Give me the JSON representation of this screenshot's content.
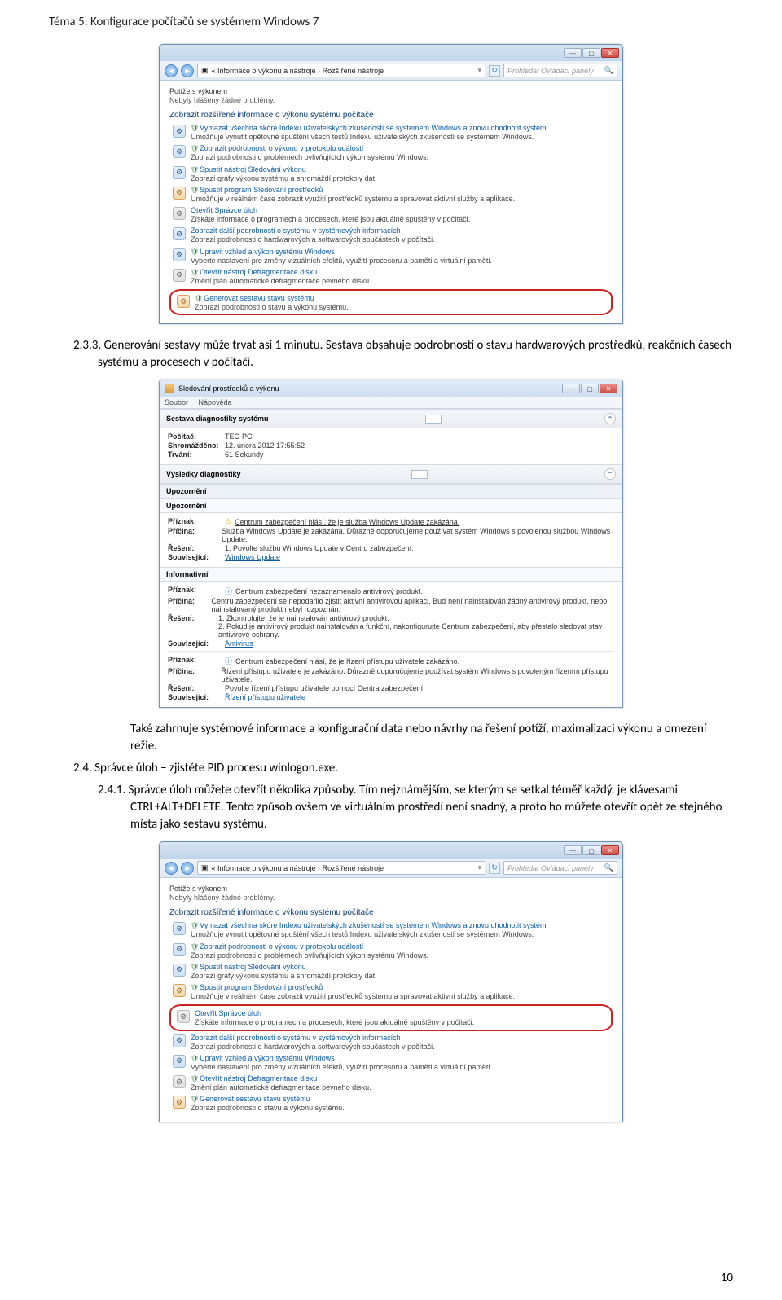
{
  "doc": {
    "header": "Téma 5: Konfigurace počítačů se systémem Windows 7",
    "page_number": "10",
    "p233": "2.3.3.  Generování sestavy může trvat asi 1 minutu. Sestava obsahuje podrobnosti o stavu hardwarových prostředků, reakčních časech systému a procesech v počítači.",
    "p_after_report": "Také zahrnuje systémové informace a konfigurační data nebo návrhy na řešení potíží, maximalizaci výkonu a omezení režie.",
    "p24": "2.4.  Správce úloh – zjistěte PID procesu winlogon.exe.",
    "p241": "2.4.1.  Správce úloh můžete otevřít několika způsoby. Tím nejznámějším, se kterým se setkal téměř každý, je klávesami CTRL+ALT+DELETE. Tento způsob ovšem ve virtuálním prostředí není snadný, a proto ho můžete otevřít opět ze stejného místa jako sestavu systému."
  },
  "cp": {
    "breadcrumb_a": "Informace o výkonu a nástroje",
    "breadcrumb_b": "Rozšířené nástroje",
    "search_placeholder": "Prohledat Ovládací panely",
    "issues_head": "Potíže s výkonem",
    "issues_none": "Nebyly hlášeny žádné problémy.",
    "section": "Zobrazit rozšířené informace o výkonu systému počítače",
    "tools": [
      {
        "title": "Vymazat všechna skóre Indexu uživatelských zkušeností se systémem Windows a znovu ohodnotit systém",
        "desc": "Umožňuje vynutit opětovné spuštění všech testů Indexu uživatelských zkušeností se systémem Windows.",
        "shield": true,
        "icon": "blue"
      },
      {
        "title": "Zobrazit podrobnosti o výkonu v protokolu událostí",
        "desc": "Zobrazí podrobnosti o problémech ovlivňujících výkon systému Windows.",
        "shield": true,
        "icon": "blue"
      },
      {
        "title": "Spustit nástroj Sledování výkonu",
        "desc": "Zobrazí grafy výkonu systému a shromáždí protokoly dat.",
        "shield": true,
        "icon": "blue"
      },
      {
        "title": "Spustit program Sledování prostředků",
        "desc": "Umožňuje v reálném čase zobrazit využití prostředků systému a spravovat aktivní služby a aplikace.",
        "shield": true,
        "icon": "orange"
      },
      {
        "title": "Otevřít Správce úloh",
        "desc": "Získáte informace o programech a procesech, které jsou aktuálně spuštěny v počítači.",
        "shield": false,
        "icon": "grey"
      },
      {
        "title": "Zobrazit další podrobnosti o systému v systémových informacích",
        "desc": "Zobrazí podrobnosti o hardwarových a softwarových součástech v počítači.",
        "shield": false,
        "icon": "blue"
      },
      {
        "title": "Upravit vzhled a výkon systému Windows",
        "desc": "Vyberte nastavení pro změny vizuálních efektů, využití procesoru a paměti a virtuální paměti.",
        "shield": true,
        "icon": "blue"
      },
      {
        "title": "Otevřít nástroj Defragmentace disku",
        "desc": "Změní plán automatické defragmentace pevného disku.",
        "shield": true,
        "icon": "grey"
      },
      {
        "title": "Generovat sestavu stavu systému",
        "desc": "Zobrazí podrobnosti o stavu a výkonu systému.",
        "shield": true,
        "icon": "orange"
      }
    ]
  },
  "rp": {
    "window_title": "Sledování prostředků a výkonu",
    "menu_file": "Soubor",
    "menu_help": "Nápověda",
    "band_sys": "Sestava diagnostiky systému",
    "pc_lbl": "Počítač:",
    "pc_val": "TEC-PC",
    "col_lbl": "Shromážděno:",
    "col_val": "12. února 2012 17:55:52",
    "dur_lbl": "Trvání:",
    "dur_val": "61 Sekundy",
    "band_res": "Výsledky diagnostiky",
    "sub_warn": "Upozornění",
    "sub_upo": "Upozornění",
    "w1_sym_lbl": "Příznak:",
    "w1_sym": "Centrum zabezpečení hlásí, že je služba Windows Update zakázána.",
    "w1_cause_lbl": "Příčina:",
    "w1_cause": "Služba Windows Update je zakázána. Důrazně doporučujeme používat systém Windows s povolenou službou Windows Update.",
    "w1_fix_lbl": "Řešení:",
    "w1_fix": "1. Povolte službu Windows Update v Centru zabezpečení.",
    "w1_rel_lbl": "Související:",
    "w1_rel": "Windows Update",
    "sub_info": "Informativní",
    "i1_sym": "Centrum zabezpečení nezaznamenalo antivirový produkt.",
    "i1_cause": "Centru zabezpečení se nepodařilo zjistit aktivní antivirovou aplikaci. Buď není nainstalován žádný antivirový produkt, nebo nainstalovaný produkt nebyl rozpoznán.",
    "i1_fix1": "1. Zkontrolujte, že je nainstalován antivirový produkt.",
    "i1_fix2": "2. Pokud je antivirový produkt nainstalován a funkční, nakonfigurujte Centrum zabezpečení, aby přestalo sledovat stav antivirové ochrany.",
    "i1_rel": "Antivirus",
    "i2_sym": "Centrum zabezpečení hlásí, že je řízení přístupu uživatele zakázáno.",
    "i2_cause": "Řízení přístupu uživatele je zakázáno. Důrazně doporučujeme používat systém Windows s povoleným řízením přístupu uživatele.",
    "i2_fix": "Povolte řízení přístupu uživatele pomocí Centra zabezpečení.",
    "i2_rel": "Řízení přístupu uživatele"
  }
}
